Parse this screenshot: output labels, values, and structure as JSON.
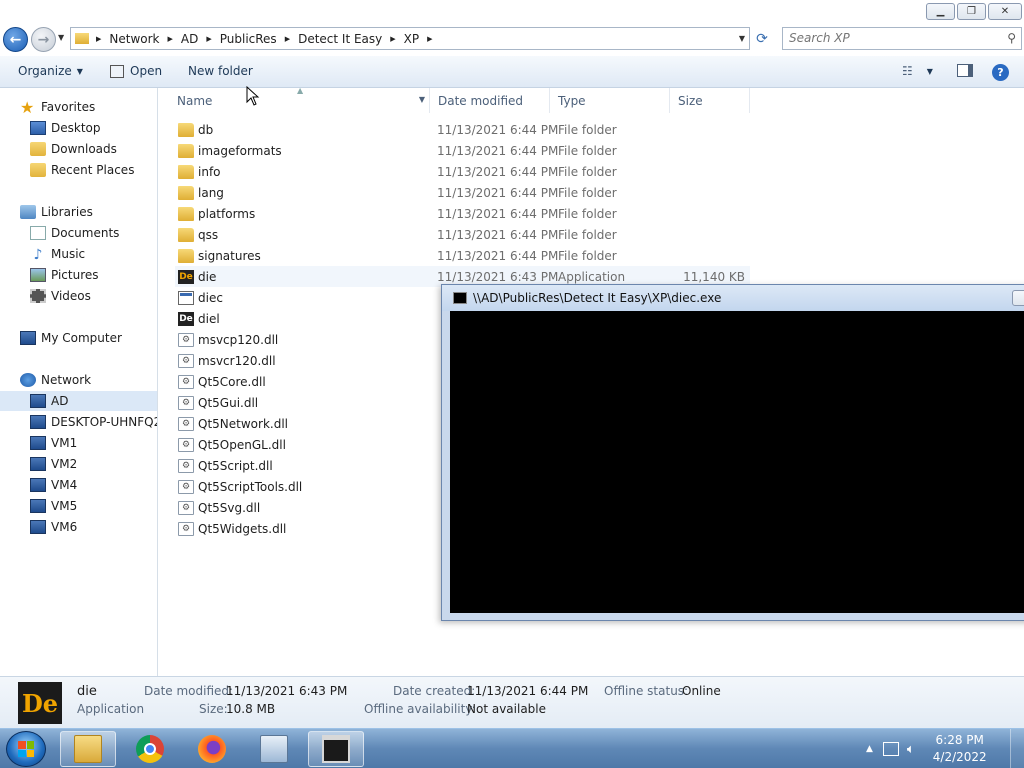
{
  "address_bar": {
    "crumbs": [
      "Network",
      "AD",
      "PublicRes",
      "Detect It Easy",
      "XP"
    ]
  },
  "search": {
    "placeholder": "Search XP"
  },
  "toolbar": {
    "organize_label": "Organize",
    "open_label": "Open",
    "new_folder_label": "New folder"
  },
  "nav": {
    "favorites_label": "Favorites",
    "favorites": [
      "Desktop",
      "Downloads",
      "Recent Places"
    ],
    "libraries_label": "Libraries",
    "libraries": [
      "Documents",
      "Music",
      "Pictures",
      "Videos"
    ],
    "computer_label": "My Computer",
    "network_label": "Network",
    "network_items": [
      "AD",
      "DESKTOP-UHNFQ2K",
      "VM1",
      "VM2",
      "VM4",
      "VM5",
      "VM6"
    ],
    "selected": "AD"
  },
  "columns": {
    "name": "Name",
    "date": "Date modified",
    "type": "Type",
    "size": "Size"
  },
  "files": [
    {
      "name": "db",
      "date": "11/13/2021 6:44 PM",
      "type": "File folder",
      "size": "",
      "icon": "folder-icon"
    },
    {
      "name": "imageformats",
      "date": "11/13/2021 6:44 PM",
      "type": "File folder",
      "size": "",
      "icon": "folder-icon"
    },
    {
      "name": "info",
      "date": "11/13/2021 6:44 PM",
      "type": "File folder",
      "size": "",
      "icon": "folder-icon"
    },
    {
      "name": "lang",
      "date": "11/13/2021 6:44 PM",
      "type": "File folder",
      "size": "",
      "icon": "folder-icon"
    },
    {
      "name": "platforms",
      "date": "11/13/2021 6:44 PM",
      "type": "File folder",
      "size": "",
      "icon": "folder-icon"
    },
    {
      "name": "qss",
      "date": "11/13/2021 6:44 PM",
      "type": "File folder",
      "size": "",
      "icon": "folder-icon"
    },
    {
      "name": "signatures",
      "date": "11/13/2021 6:44 PM",
      "type": "File folder",
      "size": "",
      "icon": "folder-icon"
    },
    {
      "name": "die",
      "date": "11/13/2021 6:43 PM",
      "type": "Application",
      "size": "11,140 KB",
      "icon": "die-app-icon"
    },
    {
      "name": "diec",
      "date": "",
      "type": "",
      "size": "",
      "icon": "console-app-icon"
    },
    {
      "name": "diel",
      "date": "",
      "type": "",
      "size": "",
      "icon": "diel-app-icon"
    },
    {
      "name": "msvcp120.dll",
      "date": "",
      "type": "",
      "size": "",
      "icon": "dll-icon"
    },
    {
      "name": "msvcr120.dll",
      "date": "",
      "type": "",
      "size": "",
      "icon": "dll-icon"
    },
    {
      "name": "Qt5Core.dll",
      "date": "",
      "type": "",
      "size": "",
      "icon": "dll-icon"
    },
    {
      "name": "Qt5Gui.dll",
      "date": "",
      "type": "",
      "size": "",
      "icon": "dll-icon"
    },
    {
      "name": "Qt5Network.dll",
      "date": "",
      "type": "",
      "size": "",
      "icon": "dll-icon"
    },
    {
      "name": "Qt5OpenGL.dll",
      "date": "",
      "type": "",
      "size": "",
      "icon": "dll-icon"
    },
    {
      "name": "Qt5Script.dll",
      "date": "",
      "type": "",
      "size": "",
      "icon": "dll-icon"
    },
    {
      "name": "Qt5ScriptTools.dll",
      "date": "",
      "type": "",
      "size": "",
      "icon": "dll-icon"
    },
    {
      "name": "Qt5Svg.dll",
      "date": "",
      "type": "",
      "size": "",
      "icon": "dll-icon"
    },
    {
      "name": "Qt5Widgets.dll",
      "date": "",
      "type": "",
      "size": "",
      "icon": "dll-icon"
    }
  ],
  "console_window": {
    "title": "\\\\AD\\PublicRes\\Detect It Easy\\XP\\diec.exe"
  },
  "details": {
    "icon_text": "De",
    "name": "die",
    "kind": "Application",
    "date_modified_label": "Date modified:",
    "date_modified": "11/13/2021 6:43 PM",
    "size_label": "Size:",
    "size": "10.8 MB",
    "date_created_label": "Date created:",
    "date_created": "11/13/2021 6:44 PM",
    "offline_availability_label": "Offline availability:",
    "offline_availability": "Not available",
    "offline_status_label": "Offline status:",
    "offline_status": "Online"
  },
  "taskbar": {
    "apps": [
      "explorer-icon",
      "chrome-icon",
      "firefox-icon",
      "control-panel-icon",
      "console-icon"
    ],
    "clock_time": "6:28 PM",
    "clock_date": "4/2/2022"
  }
}
